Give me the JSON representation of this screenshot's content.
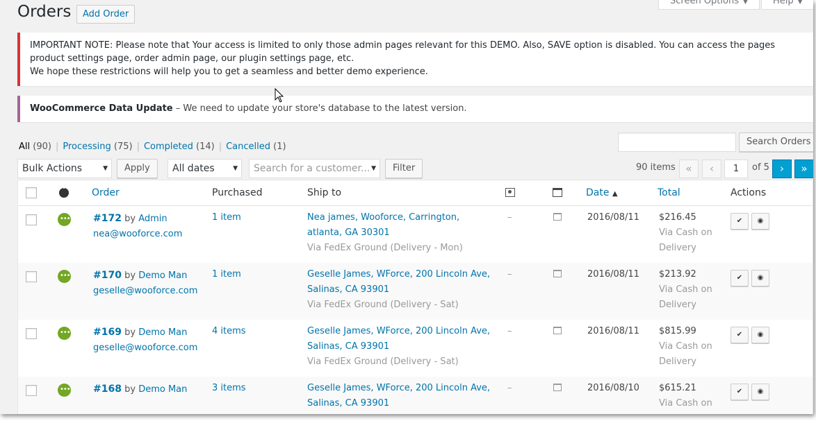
{
  "header": {
    "title": "Orders",
    "add_button": "Add Order",
    "screen_options": "Screen Options",
    "help": "Help"
  },
  "notices": {
    "important": "IMPORTANT NOTE: Please note that Your access is limited to only those admin pages relevant for this DEMO. Also, SAVE option is disabled. You can access the pages product settings page, order admin page, our plugin settings page, etc.",
    "important_line2": "We hope these restrictions will help you to get a seamless and better demo experience.",
    "update_title": "WooCommerce Data Update",
    "update_text": " – We need to update your store's database to the latest version."
  },
  "filters": {
    "all": "All",
    "all_count": "(90)",
    "processing": "Processing",
    "processing_count": "(75)",
    "completed": "Completed",
    "completed_count": "(14)",
    "cancelled": "Cancelled",
    "cancelled_count": "(1)",
    "search_button": "Search Orders",
    "bulk_actions": "Bulk Actions",
    "apply": "Apply",
    "dates": "All dates",
    "customer_placeholder": "Search for a customer...",
    "filter": "Filter"
  },
  "pagination": {
    "items": "90 items",
    "current": "1",
    "of": "of 5",
    "first": "«",
    "prev": "‹",
    "next": "›",
    "last": "»"
  },
  "columns": {
    "order": "Order",
    "purchased": "Purchased",
    "ship_to": "Ship to",
    "date": "Date",
    "total": "Total",
    "actions": "Actions"
  },
  "orders": [
    {
      "number": "#172",
      "by": "by",
      "customer": "Admin",
      "email": "nea@wooforce.com",
      "purchased": "1 item",
      "ship_line1": "Nea james, Wooforce, Carrington,",
      "ship_line2": "atlanta, GA 30301",
      "ship_via": "Via FedEx Ground (Delivery - Mon)",
      "billing": "–",
      "date": "2016/08/11",
      "total": "$216.45",
      "payment_line1": "Via Cash on",
      "payment_line2": "Delivery"
    },
    {
      "number": "#170",
      "by": "by",
      "customer": "Demo Man",
      "email": "geselle@wooforce.com",
      "purchased": "1 item",
      "ship_line1": "Geselle James, WForce, 200 Lincoln Ave,",
      "ship_line2": "Salinas, CA 93901",
      "ship_via": "Via FedEx Ground (Delivery - Sat)",
      "billing": "–",
      "date": "2016/08/11",
      "total": "$213.92",
      "payment_line1": "Via Cash on",
      "payment_line2": "Delivery"
    },
    {
      "number": "#169",
      "by": "by",
      "customer": "Demo Man",
      "email": "geselle@wooforce.com",
      "purchased": "4 items",
      "ship_line1": "Geselle James, WForce, 200 Lincoln Ave,",
      "ship_line2": "Salinas, CA 93901",
      "ship_via": "Via FedEx Ground (Delivery - Sat)",
      "billing": "–",
      "date": "2016/08/11",
      "total": "$815.99",
      "payment_line1": "Via Cash on",
      "payment_line2": "Delivery"
    },
    {
      "number": "#168",
      "by": "by",
      "customer": "Demo Man",
      "email": "",
      "purchased": "3 items",
      "ship_line1": "Geselle James, WForce, 200 Lincoln Ave,",
      "ship_line2": "Salinas, CA 93901",
      "ship_via": "",
      "billing": "–",
      "date": "2016/08/10",
      "total": "$615.21",
      "payment_line1": "Via Cash on",
      "payment_line2": ""
    }
  ],
  "colors": {
    "link": "#0073aa",
    "processing": "#73a724",
    "notice_error": "#dc3232",
    "notice_woo": "#a46497",
    "pager_active": "#00a0d2"
  },
  "icons": {
    "status": "status-icon",
    "shipping": "shipping-address-icon",
    "notes": "customer-notes-icon",
    "complete": "checkmark-icon",
    "view": "eye-icon"
  }
}
